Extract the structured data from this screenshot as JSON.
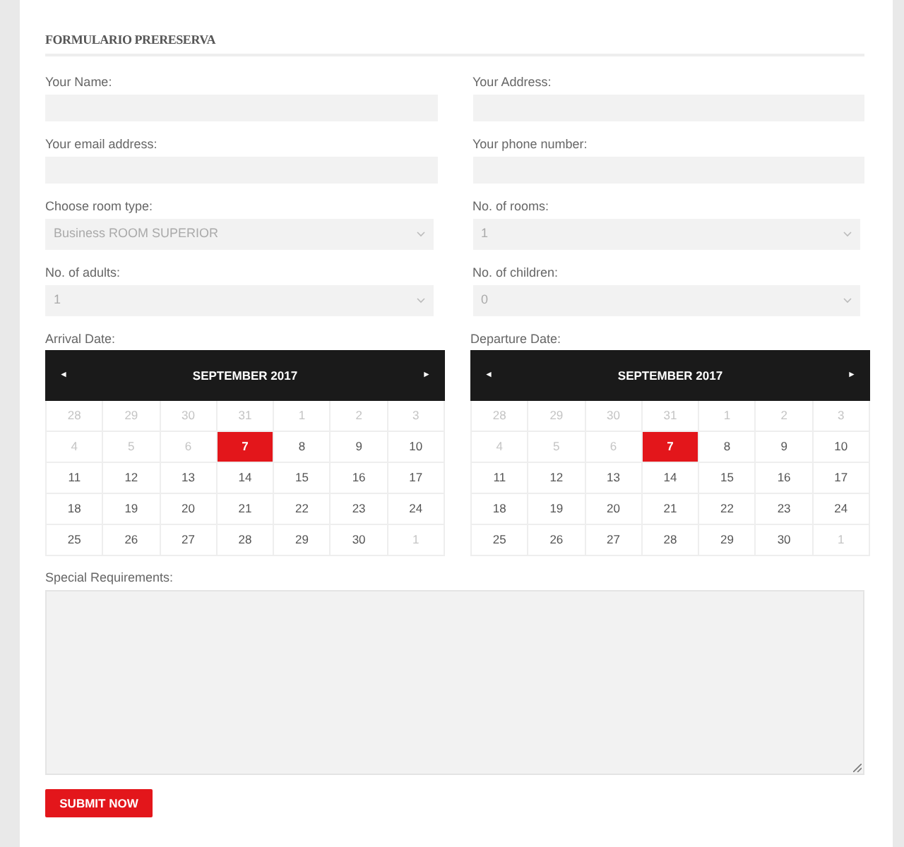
{
  "form": {
    "title": "FORMULARIO PRERESERVA",
    "fields": [
      {
        "kind": "text",
        "label": "Your Name:"
      },
      {
        "kind": "text",
        "label": "Your Address:"
      },
      {
        "kind": "text",
        "label": "Your email address:"
      },
      {
        "kind": "text",
        "label": "Your phone number:"
      },
      {
        "kind": "select",
        "label": "Choose room type:",
        "value": "Business ROOM SUPERIOR"
      },
      {
        "kind": "select",
        "label": "No. of rooms:",
        "value": "1"
      },
      {
        "kind": "select",
        "label": "No. of adults:",
        "value": "1"
      },
      {
        "kind": "select",
        "label": "No. of children:",
        "value": "0"
      }
    ],
    "calendars": [
      {
        "label": "Arrival Date:",
        "prev": "◄",
        "month": "SEPTEMBER 2017",
        "next": "►",
        "weeks": [
          [
            {
              "day": "28",
              "muted": true,
              "selected": false
            },
            {
              "day": "29",
              "muted": true,
              "selected": false
            },
            {
              "day": "30",
              "muted": true,
              "selected": false
            },
            {
              "day": "31",
              "muted": true,
              "selected": false
            },
            {
              "day": "1",
              "muted": true,
              "selected": false
            },
            {
              "day": "2",
              "muted": true,
              "selected": false
            },
            {
              "day": "3",
              "muted": true,
              "selected": false
            }
          ],
          [
            {
              "day": "4",
              "muted": true,
              "selected": false
            },
            {
              "day": "5",
              "muted": true,
              "selected": false
            },
            {
              "day": "6",
              "muted": true,
              "selected": false
            },
            {
              "day": "7",
              "muted": false,
              "selected": true
            },
            {
              "day": "8",
              "muted": false,
              "selected": false
            },
            {
              "day": "9",
              "muted": false,
              "selected": false
            },
            {
              "day": "10",
              "muted": false,
              "selected": false
            }
          ],
          [
            {
              "day": "11",
              "muted": false,
              "selected": false
            },
            {
              "day": "12",
              "muted": false,
              "selected": false
            },
            {
              "day": "13",
              "muted": false,
              "selected": false
            },
            {
              "day": "14",
              "muted": false,
              "selected": false
            },
            {
              "day": "15",
              "muted": false,
              "selected": false
            },
            {
              "day": "16",
              "muted": false,
              "selected": false
            },
            {
              "day": "17",
              "muted": false,
              "selected": false
            }
          ],
          [
            {
              "day": "18",
              "muted": false,
              "selected": false
            },
            {
              "day": "19",
              "muted": false,
              "selected": false
            },
            {
              "day": "20",
              "muted": false,
              "selected": false
            },
            {
              "day": "21",
              "muted": false,
              "selected": false
            },
            {
              "day": "22",
              "muted": false,
              "selected": false
            },
            {
              "day": "23",
              "muted": false,
              "selected": false
            },
            {
              "day": "24",
              "muted": false,
              "selected": false
            }
          ],
          [
            {
              "day": "25",
              "muted": false,
              "selected": false
            },
            {
              "day": "26",
              "muted": false,
              "selected": false
            },
            {
              "day": "27",
              "muted": false,
              "selected": false
            },
            {
              "day": "28",
              "muted": false,
              "selected": false
            },
            {
              "day": "29",
              "muted": false,
              "selected": false
            },
            {
              "day": "30",
              "muted": false,
              "selected": false
            },
            {
              "day": "1",
              "muted": true,
              "selected": false
            }
          ]
        ]
      },
      {
        "label": "Departure Date:",
        "prev": "◄",
        "month": "SEPTEMBER 2017",
        "next": "►",
        "weeks": [
          [
            {
              "day": "28",
              "muted": true,
              "selected": false
            },
            {
              "day": "29",
              "muted": true,
              "selected": false
            },
            {
              "day": "30",
              "muted": true,
              "selected": false
            },
            {
              "day": "31",
              "muted": true,
              "selected": false
            },
            {
              "day": "1",
              "muted": true,
              "selected": false
            },
            {
              "day": "2",
              "muted": true,
              "selected": false
            },
            {
              "day": "3",
              "muted": true,
              "selected": false
            }
          ],
          [
            {
              "day": "4",
              "muted": true,
              "selected": false
            },
            {
              "day": "5",
              "muted": true,
              "selected": false
            },
            {
              "day": "6",
              "muted": true,
              "selected": false
            },
            {
              "day": "7",
              "muted": false,
              "selected": true
            },
            {
              "day": "8",
              "muted": false,
              "selected": false
            },
            {
              "day": "9",
              "muted": false,
              "selected": false
            },
            {
              "day": "10",
              "muted": false,
              "selected": false
            }
          ],
          [
            {
              "day": "11",
              "muted": false,
              "selected": false
            },
            {
              "day": "12",
              "muted": false,
              "selected": false
            },
            {
              "day": "13",
              "muted": false,
              "selected": false
            },
            {
              "day": "14",
              "muted": false,
              "selected": false
            },
            {
              "day": "15",
              "muted": false,
              "selected": false
            },
            {
              "day": "16",
              "muted": false,
              "selected": false
            },
            {
              "day": "17",
              "muted": false,
              "selected": false
            }
          ],
          [
            {
              "day": "18",
              "muted": false,
              "selected": false
            },
            {
              "day": "19",
              "muted": false,
              "selected": false
            },
            {
              "day": "20",
              "muted": false,
              "selected": false
            },
            {
              "day": "21",
              "muted": false,
              "selected": false
            },
            {
              "day": "22",
              "muted": false,
              "selected": false
            },
            {
              "day": "23",
              "muted": false,
              "selected": false
            },
            {
              "day": "24",
              "muted": false,
              "selected": false
            }
          ],
          [
            {
              "day": "25",
              "muted": false,
              "selected": false
            },
            {
              "day": "26",
              "muted": false,
              "selected": false
            },
            {
              "day": "27",
              "muted": false,
              "selected": false
            },
            {
              "day": "28",
              "muted": false,
              "selected": false
            },
            {
              "day": "29",
              "muted": false,
              "selected": false
            },
            {
              "day": "30",
              "muted": false,
              "selected": false
            },
            {
              "day": "1",
              "muted": true,
              "selected": false
            }
          ]
        ]
      }
    ],
    "requirements": {
      "label": "Special Requirements:"
    },
    "submit": "SUBMIT NOW"
  }
}
